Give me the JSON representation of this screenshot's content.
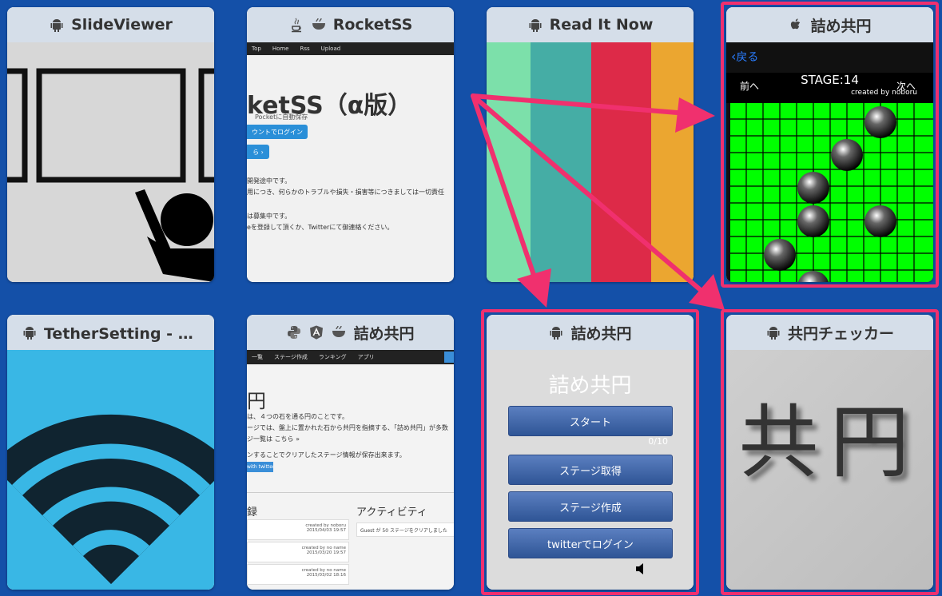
{
  "cards": [
    {
      "title": "SlideViewer",
      "icons": [
        "android-icon"
      ]
    },
    {
      "title": "RocketSS",
      "icons": [
        "java-icon",
        "coffee-icon"
      ],
      "nav": [
        "Top",
        "Home",
        "Rss",
        "Upload"
      ],
      "heading": "ketSS（α版）",
      "sub": "Pocketに自動保存",
      "login_btn": "ウントでログイン",
      "more_btn": "ら ›",
      "lines": [
        "開発途中です。",
        "用につき、何らかのトラブルや損失・損害等につきましては一切責任",
        "は募集中です。",
        "eを登録して頂くか、Twitterにて御連絡ください。"
      ]
    },
    {
      "title": "Read It Now",
      "icons": [
        "android-icon"
      ],
      "stripes": [
        "#7ce0aa",
        "#45ada5",
        "#dd2a48",
        "#eba630"
      ]
    },
    {
      "title": "詰め共円",
      "icons": [
        "apple-icon"
      ],
      "back": "戻る",
      "prev": "前へ",
      "next": "次へ",
      "stage": "STAGE:14",
      "credit": "created by noboru"
    },
    {
      "title": "TetherSetting - 無…",
      "icons": [
        "android-icon"
      ]
    },
    {
      "title": "詰め共円",
      "icons": [
        "python-icon",
        "angular-icon",
        "coffee-icon"
      ],
      "nav": [
        "一覧",
        "ステージ作成",
        "ランキング",
        "アプリ"
      ],
      "heading": "円",
      "lines": [
        "は、４つの石を通る円のことです。",
        "ージでは、盤上に置かれた石から共円を指摘する、「詰め共円」が多数",
        "ジ一覧は こちら »",
        "ンすることでクリアしたステージ情報が保存出来ます。",
        "with twitter »"
      ],
      "section_left": "録",
      "section_right": "アクティビティ",
      "activity": "Guest が 50 ステージをクリアしました",
      "rows": [
        [
          "created by noboru",
          "2015/04/03 19:57"
        ],
        [
          "created by no name",
          "2015/03/20 19:57"
        ],
        [
          "created by no name",
          "2015/03/02 18:16"
        ]
      ]
    },
    {
      "title": "詰め共円",
      "icons": [
        "android-icon"
      ],
      "app_title": "詰め共円",
      "buttons": [
        "スタート",
        "ステージ取得",
        "ステージ作成",
        "twitterでログイン"
      ],
      "progress": "0/10"
    },
    {
      "title": "共円チェッカー",
      "icons": [
        "android-icon"
      ],
      "kanji": "共円"
    }
  ]
}
